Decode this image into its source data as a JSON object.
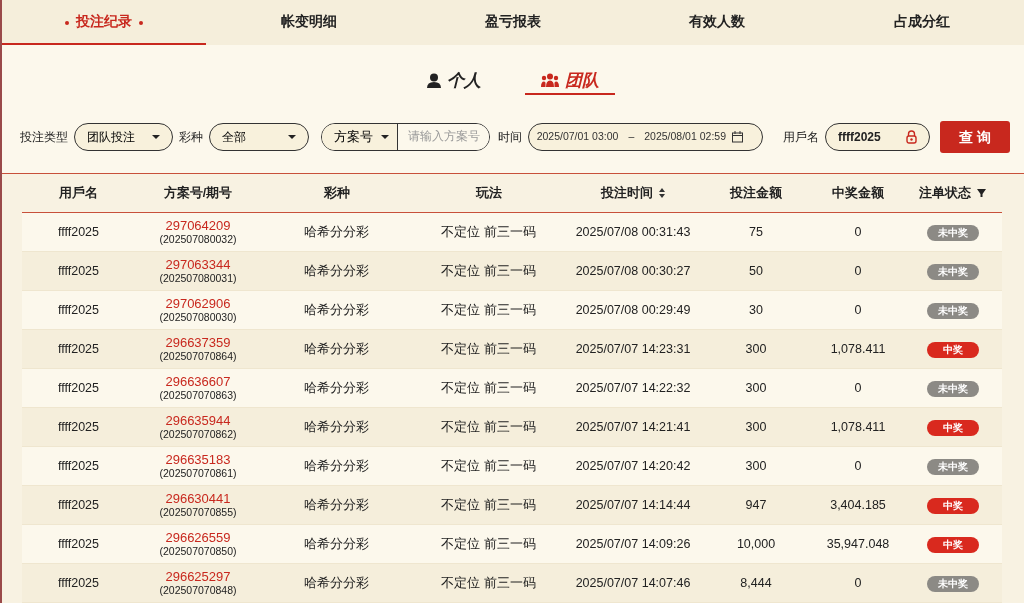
{
  "tabs": [
    {
      "label": "投注纪录",
      "selected": true
    },
    {
      "label": "帐变明细",
      "selected": false
    },
    {
      "label": "盈亏报表",
      "selected": false
    },
    {
      "label": "有效人数",
      "selected": false
    },
    {
      "label": "占成分红",
      "selected": false
    }
  ],
  "scope_tabs": [
    {
      "label": "个人",
      "kind": "person",
      "selected": false
    },
    {
      "label": "团队",
      "kind": "team",
      "selected": true
    }
  ],
  "filters": {
    "bet_type": {
      "label": "投注类型",
      "value": "团队投注"
    },
    "lottery": {
      "label": "彩种",
      "value": "全部"
    },
    "plan": {
      "selector": "方案号",
      "placeholder": "请输入方案号"
    },
    "time": {
      "label": "时间",
      "start": "2025/07/01 03:00",
      "separator": "–",
      "end": "2025/08/01 02:59"
    },
    "user": {
      "label": "用戶名",
      "value": "ffff2025"
    },
    "query_button": "查 询"
  },
  "table": {
    "columns": [
      {
        "label": "用戶名"
      },
      {
        "label": "方案号/期号"
      },
      {
        "label": "彩种"
      },
      {
        "label": "玩法"
      },
      {
        "label": "投注时间",
        "kind": "sort"
      },
      {
        "label": "投注金额"
      },
      {
        "label": "中奖金额"
      },
      {
        "label": "注单状态",
        "kind": "filter"
      }
    ],
    "rows": [
      {
        "user": "ffff2025",
        "plan": "297064209",
        "period": "(202507080032)",
        "lottery": "哈希分分彩",
        "play": "不定位 前三一码",
        "time": "2025/07/08 00:31:43",
        "bet": "75",
        "win": "0",
        "status": "未中奖",
        "kind": "lost"
      },
      {
        "user": "ffff2025",
        "plan": "297063344",
        "period": "(202507080031)",
        "lottery": "哈希分分彩",
        "play": "不定位 前三一码",
        "time": "2025/07/08 00:30:27",
        "bet": "50",
        "win": "0",
        "status": "未中奖",
        "kind": "lost"
      },
      {
        "user": "ffff2025",
        "plan": "297062906",
        "period": "(202507080030)",
        "lottery": "哈希分分彩",
        "play": "不定位 前三一码",
        "time": "2025/07/08 00:29:49",
        "bet": "30",
        "win": "0",
        "status": "未中奖",
        "kind": "lost"
      },
      {
        "user": "ffff2025",
        "plan": "296637359",
        "period": "(202507070864)",
        "lottery": "哈希分分彩",
        "play": "不定位 前三一码",
        "time": "2025/07/07 14:23:31",
        "bet": "300",
        "win": "1,078.411",
        "status": "中奖",
        "kind": "won"
      },
      {
        "user": "ffff2025",
        "plan": "296636607",
        "period": "(202507070863)",
        "lottery": "哈希分分彩",
        "play": "不定位 前三一码",
        "time": "2025/07/07 14:22:32",
        "bet": "300",
        "win": "0",
        "status": "未中奖",
        "kind": "lost"
      },
      {
        "user": "ffff2025",
        "plan": "296635944",
        "period": "(202507070862)",
        "lottery": "哈希分分彩",
        "play": "不定位 前三一码",
        "time": "2025/07/07 14:21:41",
        "bet": "300",
        "win": "1,078.411",
        "status": "中奖",
        "kind": "won"
      },
      {
        "user": "ffff2025",
        "plan": "296635183",
        "period": "(202507070861)",
        "lottery": "哈希分分彩",
        "play": "不定位 前三一码",
        "time": "2025/07/07 14:20:42",
        "bet": "300",
        "win": "0",
        "status": "未中奖",
        "kind": "lost"
      },
      {
        "user": "ffff2025",
        "plan": "296630441",
        "period": "(202507070855)",
        "lottery": "哈希分分彩",
        "play": "不定位 前三一码",
        "time": "2025/07/07 14:14:44",
        "bet": "947",
        "win": "3,404.185",
        "status": "中奖",
        "kind": "won"
      },
      {
        "user": "ffff2025",
        "plan": "296626559",
        "period": "(202507070850)",
        "lottery": "哈希分分彩",
        "play": "不定位 前三一码",
        "time": "2025/07/07 14:09:26",
        "bet": "10,000",
        "win": "35,947.048",
        "status": "中奖",
        "kind": "won"
      },
      {
        "user": "ffff2025",
        "plan": "296625297",
        "period": "(202507070848)",
        "lottery": "哈希分分彩",
        "play": "不定位 前三一码",
        "time": "2025/07/07 14:07:46",
        "bet": "8,444",
        "win": "0",
        "status": "未中奖",
        "kind": "lost"
      }
    ]
  }
}
